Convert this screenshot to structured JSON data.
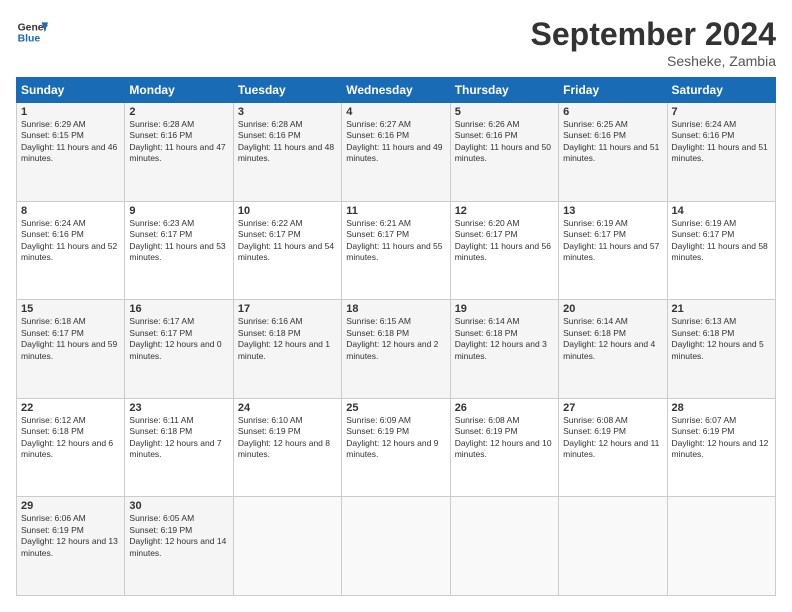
{
  "header": {
    "logo_line1": "General",
    "logo_line2": "Blue",
    "month": "September 2024",
    "location": "Sesheke, Zambia"
  },
  "weekdays": [
    "Sunday",
    "Monday",
    "Tuesday",
    "Wednesday",
    "Thursday",
    "Friday",
    "Saturday"
  ],
  "weeks": [
    [
      {
        "day": "1",
        "sunrise": "6:29 AM",
        "sunset": "6:15 PM",
        "daylight": "11 hours and 46 minutes."
      },
      {
        "day": "2",
        "sunrise": "6:28 AM",
        "sunset": "6:16 PM",
        "daylight": "11 hours and 47 minutes."
      },
      {
        "day": "3",
        "sunrise": "6:28 AM",
        "sunset": "6:16 PM",
        "daylight": "11 hours and 48 minutes."
      },
      {
        "day": "4",
        "sunrise": "6:27 AM",
        "sunset": "6:16 PM",
        "daylight": "11 hours and 49 minutes."
      },
      {
        "day": "5",
        "sunrise": "6:26 AM",
        "sunset": "6:16 PM",
        "daylight": "11 hours and 50 minutes."
      },
      {
        "day": "6",
        "sunrise": "6:25 AM",
        "sunset": "6:16 PM",
        "daylight": "11 hours and 51 minutes."
      },
      {
        "day": "7",
        "sunrise": "6:24 AM",
        "sunset": "6:16 PM",
        "daylight": "11 hours and 51 minutes."
      }
    ],
    [
      {
        "day": "8",
        "sunrise": "6:24 AM",
        "sunset": "6:16 PM",
        "daylight": "11 hours and 52 minutes."
      },
      {
        "day": "9",
        "sunrise": "6:23 AM",
        "sunset": "6:17 PM",
        "daylight": "11 hours and 53 minutes."
      },
      {
        "day": "10",
        "sunrise": "6:22 AM",
        "sunset": "6:17 PM",
        "daylight": "11 hours and 54 minutes."
      },
      {
        "day": "11",
        "sunrise": "6:21 AM",
        "sunset": "6:17 PM",
        "daylight": "11 hours and 55 minutes."
      },
      {
        "day": "12",
        "sunrise": "6:20 AM",
        "sunset": "6:17 PM",
        "daylight": "11 hours and 56 minutes."
      },
      {
        "day": "13",
        "sunrise": "6:19 AM",
        "sunset": "6:17 PM",
        "daylight": "11 hours and 57 minutes."
      },
      {
        "day": "14",
        "sunrise": "6:19 AM",
        "sunset": "6:17 PM",
        "daylight": "11 hours and 58 minutes."
      }
    ],
    [
      {
        "day": "15",
        "sunrise": "6:18 AM",
        "sunset": "6:17 PM",
        "daylight": "11 hours and 59 minutes."
      },
      {
        "day": "16",
        "sunrise": "6:17 AM",
        "sunset": "6:17 PM",
        "daylight": "12 hours and 0 minutes."
      },
      {
        "day": "17",
        "sunrise": "6:16 AM",
        "sunset": "6:18 PM",
        "daylight": "12 hours and 1 minute."
      },
      {
        "day": "18",
        "sunrise": "6:15 AM",
        "sunset": "6:18 PM",
        "daylight": "12 hours and 2 minutes."
      },
      {
        "day": "19",
        "sunrise": "6:14 AM",
        "sunset": "6:18 PM",
        "daylight": "12 hours and 3 minutes."
      },
      {
        "day": "20",
        "sunrise": "6:14 AM",
        "sunset": "6:18 PM",
        "daylight": "12 hours and 4 minutes."
      },
      {
        "day": "21",
        "sunrise": "6:13 AM",
        "sunset": "6:18 PM",
        "daylight": "12 hours and 5 minutes."
      }
    ],
    [
      {
        "day": "22",
        "sunrise": "6:12 AM",
        "sunset": "6:18 PM",
        "daylight": "12 hours and 6 minutes."
      },
      {
        "day": "23",
        "sunrise": "6:11 AM",
        "sunset": "6:18 PM",
        "daylight": "12 hours and 7 minutes."
      },
      {
        "day": "24",
        "sunrise": "6:10 AM",
        "sunset": "6:19 PM",
        "daylight": "12 hours and 8 minutes."
      },
      {
        "day": "25",
        "sunrise": "6:09 AM",
        "sunset": "6:19 PM",
        "daylight": "12 hours and 9 minutes."
      },
      {
        "day": "26",
        "sunrise": "6:08 AM",
        "sunset": "6:19 PM",
        "daylight": "12 hours and 10 minutes."
      },
      {
        "day": "27",
        "sunrise": "6:08 AM",
        "sunset": "6:19 PM",
        "daylight": "12 hours and 11 minutes."
      },
      {
        "day": "28",
        "sunrise": "6:07 AM",
        "sunset": "6:19 PM",
        "daylight": "12 hours and 12 minutes."
      }
    ],
    [
      {
        "day": "29",
        "sunrise": "6:06 AM",
        "sunset": "6:19 PM",
        "daylight": "12 hours and 13 minutes."
      },
      {
        "day": "30",
        "sunrise": "6:05 AM",
        "sunset": "6:19 PM",
        "daylight": "12 hours and 14 minutes."
      },
      null,
      null,
      null,
      null,
      null
    ]
  ]
}
